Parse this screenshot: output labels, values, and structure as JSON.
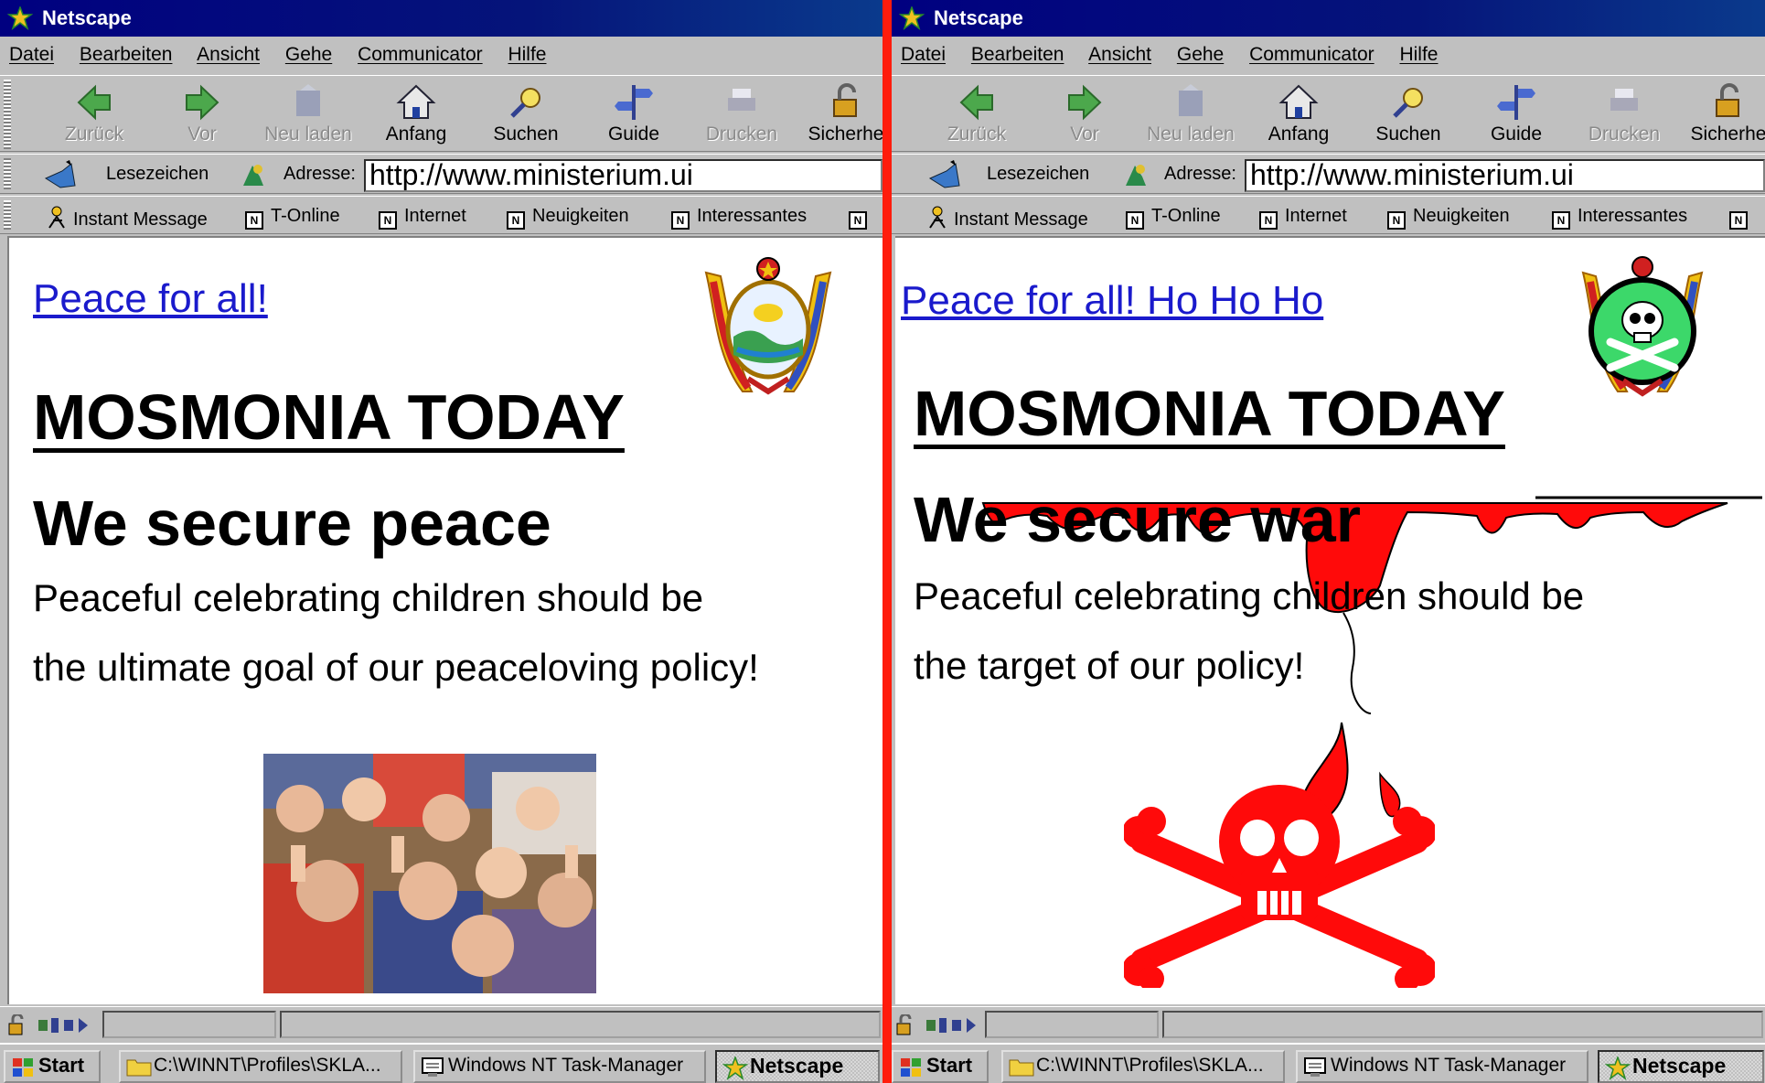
{
  "browser": {
    "title": "Netscape",
    "menu": [
      "Datei",
      "Bearbeiten",
      "Ansicht",
      "Gehe",
      "Communicator",
      "Hilfe"
    ],
    "toolbar": {
      "back": "Zurück",
      "forward": "Vor",
      "reload": "Neu laden",
      "home": "Anfang",
      "search": "Suchen",
      "guide": "Guide",
      "print": "Drucken",
      "security": "Sicherhe"
    },
    "bookmarks_label": "Lesezeichen",
    "address_label": "Adresse:",
    "url": "http://www.ministerium.ui",
    "personal": [
      "Instant Message",
      "T-Online",
      "Internet",
      "Neuigkeiten",
      "Interessantes"
    ]
  },
  "taskbar": {
    "start": "Start",
    "tasks": [
      "C:\\WINNT\\Profiles\\SKLA...",
      "Windows NT Task-Manager",
      "Netscape"
    ]
  },
  "left_page": {
    "link": "Peace for all!",
    "headline": "MOSMONIA TODAY",
    "subheadline": "We secure peace",
    "line1": "Peaceful celebrating children should be",
    "line2": "the ultimate goal of our peaceloving policy!"
  },
  "right_page": {
    "link": "Peace for all! Ho Ho Ho",
    "headline": "MOSMONIA TODAY",
    "subheadline": "We secure war",
    "line1": "Peaceful celebrating children should be",
    "line2": "the target of our  policy!"
  },
  "colors": {
    "divider": "#ff1c0c",
    "blood": "#ff0a0a",
    "link": "#1a1acc",
    "titlebar": "#000080"
  }
}
